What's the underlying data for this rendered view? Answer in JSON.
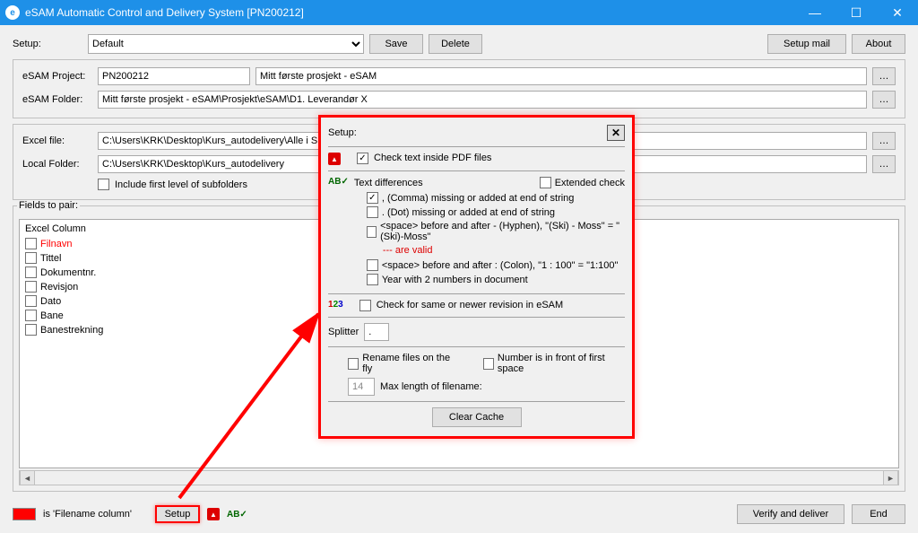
{
  "window": {
    "title": "eSAM Automatic Control and Delivery System [PN200212]"
  },
  "toolbar": {
    "setup_label": "Setup:",
    "setup_value": "Default",
    "save": "Save",
    "delete": "Delete",
    "setup_mail": "Setup mail",
    "about": "About"
  },
  "project": {
    "label": "eSAM Project:",
    "id": "PN200212",
    "name": "Mitt første prosjekt - eSAM",
    "folder_label": "eSAM Folder:",
    "folder_value": "Mitt første prosjekt - eSAM\\Prosjekt\\eSAM\\D1. Leverandør X"
  },
  "paths": {
    "excel_label": "Excel file:",
    "excel_value": "C:\\Users\\KRK\\Desktop\\Kurs_autodelivery\\Alle i SMS",
    "local_label": "Local Folder:",
    "local_value": "C:\\Users\\KRK\\Desktop\\Kurs_autodelivery",
    "include_sub": "Include first level of subfolders"
  },
  "fields": {
    "legend": "Fields to pair:",
    "header": "Excel Column",
    "items": [
      {
        "label": "Filnavn",
        "is_filename": true
      },
      {
        "label": "Tittel",
        "is_filename": false
      },
      {
        "label": "Dokumentnr.",
        "is_filename": false
      },
      {
        "label": "Revisjon",
        "is_filename": false
      },
      {
        "label": "Dato",
        "is_filename": false
      },
      {
        "label": "Bane",
        "is_filename": false
      },
      {
        "label": "Banestrekning",
        "is_filename": false
      }
    ]
  },
  "footer": {
    "legend": "is 'Filename column'",
    "setup_btn": "Setup",
    "verify_btn": "Verify and deliver",
    "end_btn": "End"
  },
  "popup": {
    "title": "Setup:",
    "check_pdf": "Check text inside PDF files",
    "text_diff": "Text differences",
    "ext_check": "Extended check",
    "opt_comma": ", (Comma) missing or added at end of string",
    "opt_dot": ". (Dot) missing or added at end of string",
    "opt_hyphen": "<space> before and after -  (Hyphen),   \"(Ski) - Moss\" = \"(Ski)-Moss\"",
    "opt_hyphen_note": "--- are valid",
    "opt_colon": "<space> before and after :  (Colon),   \"1 : 100\" = \"1:100\"",
    "opt_year": "Year with 2 numbers in document",
    "check_rev": "Check for same or newer revision in eSAM",
    "splitter_label": "Splitter",
    "splitter_value": ".",
    "rename": "Rename files on the fly",
    "number_front": "Number is in front of first space",
    "maxlen_value": "14",
    "maxlen_label": "Max length of filename:",
    "clear_cache": "Clear Cache"
  }
}
